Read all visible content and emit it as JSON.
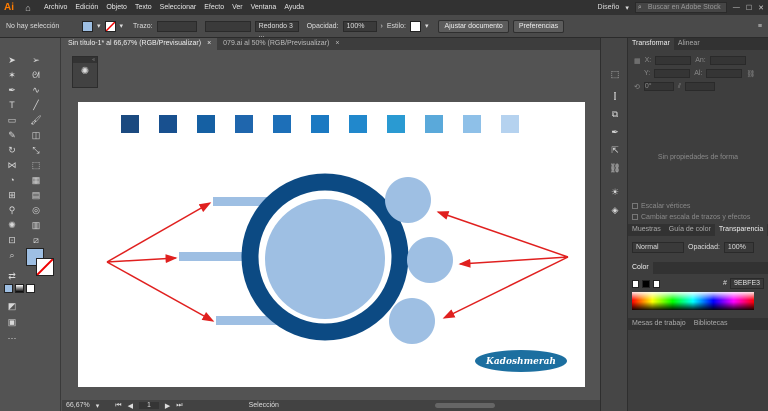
{
  "app": {
    "logo": "Ai"
  },
  "menu": [
    "Archivo",
    "Edición",
    "Objeto",
    "Texto",
    "Seleccionar",
    "Efecto",
    "Ver",
    "Ventana",
    "Ayuda"
  ],
  "menubar_right": {
    "workspace": "Diseño",
    "search_placeholder": "Buscar en Adobe Stock"
  },
  "control": {
    "selection": "No hay selección",
    "stroke_label": "Trazo:",
    "brush": "Redondo 3 ...",
    "opacity_label": "Opacidad:",
    "opacity_value": "100%",
    "style_label": "Estilo:",
    "fit_button": "Ajustar documento",
    "prefs_button": "Preferencias"
  },
  "tabs": [
    {
      "label": "Sin título-1* al 66,67% (RGB/Previsualizar)"
    },
    {
      "label": "079.ai al 50% (RGB/Previsualizar)"
    }
  ],
  "status": {
    "zoom": "66,67%",
    "page": "1",
    "mode": "Selección"
  },
  "panels": {
    "transform": {
      "tabs": [
        "Transformar",
        "Alinear"
      ],
      "x": "X:",
      "y": "Y:",
      "w": "An:",
      "h": "Al:",
      "angle": "0°",
      "empty_text": "Sin propiedades de forma",
      "scale_strokes": "Escalar vértices",
      "scale_effects": "Cambiar escala de trazos y efectos"
    },
    "transparency": {
      "tabs": [
        "Muestras",
        "Guía de color",
        "Transparencia"
      ],
      "mode": "Normal",
      "opacity_label": "Opacidad:",
      "opacity_value": "100%"
    },
    "color": {
      "title": "Color",
      "hex_symbol": "#",
      "hex": "9EBFE3"
    },
    "bottom_tabs": [
      "Mesas de trabajo",
      "Bibliotecas"
    ]
  },
  "artwork": {
    "swatches": [
      "#1b4a80",
      "#18508f",
      "#1560a3",
      "#1f66ad",
      "#1d6fb8",
      "#1b79c2",
      "#2188cc",
      "#2a9ad2",
      "#5aa9da",
      "#8ec0e8",
      "#b5d2ef"
    ],
    "ring_color": "#0c4a83",
    "fill_color": "#9ebfe3",
    "arrow_color": "#e0201f",
    "badge_text": "Kadoshmerah",
    "badge_color": "#1c6fa0"
  }
}
